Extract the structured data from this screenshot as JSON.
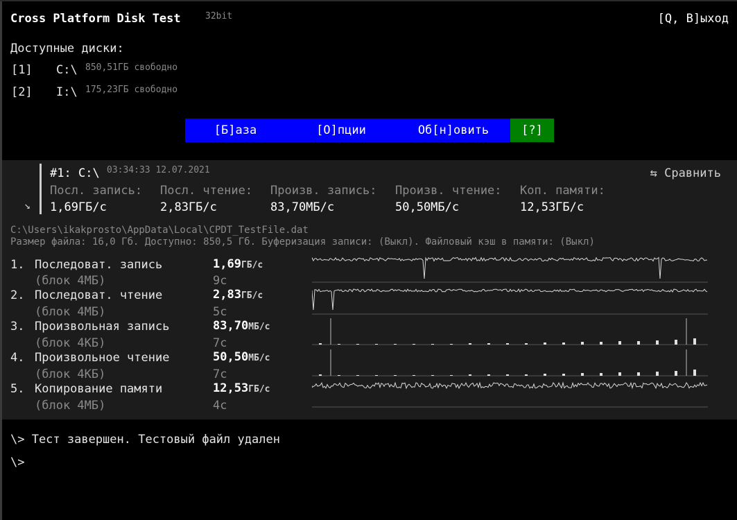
{
  "app": {
    "title": "Cross Platform Disk Test",
    "bits": "32bit",
    "exit_label": "[Q, В]ыход"
  },
  "disks": {
    "heading": "Доступные диски:",
    "items": [
      {
        "key": "[1]",
        "path": "C:\\",
        "free": "850,51ГБ свободно"
      },
      {
        "key": "[2]",
        "path": "I:\\",
        "free": "175,23ГБ свободно"
      }
    ]
  },
  "menu": {
    "base": "[Б]аза",
    "options": "[О]пции",
    "refresh": "Об[н]овить",
    "help": "[?]"
  },
  "run": {
    "id": "#1:",
    "drive": "C:\\",
    "timestamp": "03:34:33 12.07.2021",
    "compare_label": "⇆ Сравнить",
    "expand_glyph": "↘",
    "metrics": [
      {
        "label": "Посл. запись:",
        "value": "1,69ГБ/с"
      },
      {
        "label": "Посл. чтение:",
        "value": "2,83ГБ/с"
      },
      {
        "label": "Произв. запись:",
        "value": "83,70МБ/с"
      },
      {
        "label": "Произв. чтение:",
        "value": "50,50МБ/с"
      },
      {
        "label": "Коп. памяти:",
        "value": "12,53ГБ/с"
      }
    ]
  },
  "file": {
    "path": "C:\\Users\\ikakprosto\\AppData\\Local\\CPDT_TestFile.dat",
    "info": "Размер файла: 16,0 Гб. Доступно: 850,5 Гб. Буферизация записи: (Выкл). Файловый кэш в памяти: (Выкл)"
  },
  "tests": [
    {
      "num": "1.",
      "name": "Последоват. запись",
      "block": "(блок 4МБ)",
      "value": "1,69",
      "unit": "ГБ/с",
      "time": "9с"
    },
    {
      "num": "2.",
      "name": "Последоват. чтение",
      "block": "(блок 4МБ)",
      "value": "2,83",
      "unit": "ГБ/с",
      "time": "5с"
    },
    {
      "num": "3.",
      "name": "Произвольная запись",
      "block": "(блок 4КБ)",
      "value": "83,70",
      "unit": "МБ/с",
      "time": "7с"
    },
    {
      "num": "4.",
      "name": "Произвольное чтение",
      "block": "(блок 4КБ)",
      "value": "50,50",
      "unit": "МБ/с",
      "time": "7с"
    },
    {
      "num": "5.",
      "name": "Копирование памяти",
      "block": "(блок 4МБ)",
      "value": "12,53",
      "unit": "ГБ/с",
      "time": "4с"
    }
  ],
  "console": {
    "line1": "\\> Тест завершен. Тестовый файл удален",
    "prompt": "\\>"
  }
}
